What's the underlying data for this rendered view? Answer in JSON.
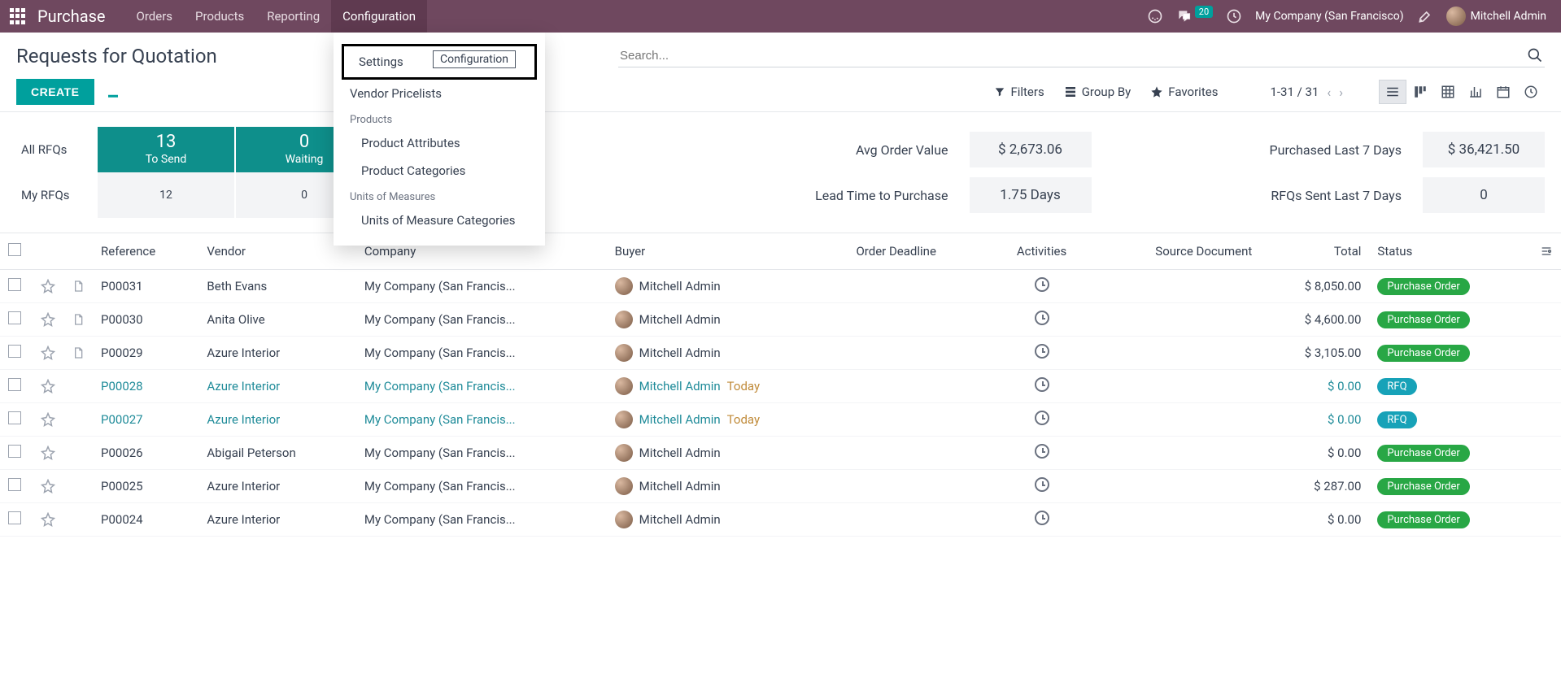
{
  "nav": {
    "app": "Purchase",
    "items": [
      "Orders",
      "Products",
      "Reporting",
      "Configuration"
    ],
    "active_index": 3,
    "msg_count": "20",
    "company": "My Company (San Francisco)",
    "user": "Mitchell Admin"
  },
  "dropdown": {
    "tooltip": "Configuration",
    "items": [
      {
        "label": "Settings",
        "type": "item",
        "boxed": true
      },
      {
        "label": "Vendor Pricelists",
        "type": "item"
      },
      {
        "label": "Products",
        "type": "header"
      },
      {
        "label": "Product Attributes",
        "type": "item",
        "indent": true
      },
      {
        "label": "Product Categories",
        "type": "item",
        "indent": true
      },
      {
        "label": "Units of Measures",
        "type": "header"
      },
      {
        "label": "Units of Measure Categories",
        "type": "item",
        "indent": true
      }
    ]
  },
  "cp": {
    "title": "Requests for Quotation",
    "create": "CREATE",
    "search_placeholder": "Search...",
    "filters": "Filters",
    "groupby": "Group By",
    "favorites": "Favorites",
    "pager": "1-31 / 31"
  },
  "dash": {
    "row_labels": [
      "All RFQs",
      "My RFQs"
    ],
    "cards": [
      {
        "big": "13",
        "sub": "To Send"
      },
      {
        "big": "0",
        "sub": "Waiting"
      }
    ],
    "my_row": [
      "12",
      "0"
    ],
    "kpis": [
      {
        "label": "Avg Order Value",
        "value": "$ 2,673.06"
      },
      {
        "label": "Purchased Last 7 Days",
        "value": "$ 36,421.50"
      },
      {
        "label": "Lead Time to Purchase",
        "value": "1.75 Days"
      },
      {
        "label": "RFQs Sent Last 7 Days",
        "value": "0"
      }
    ]
  },
  "table": {
    "headers": [
      "Reference",
      "Vendor",
      "Company",
      "Buyer",
      "Order Deadline",
      "Activities",
      "Source Document",
      "Total",
      "Status"
    ],
    "rows": [
      {
        "ref": "P00031",
        "vendor": "Beth Evans",
        "company": "My Company (San Francis...",
        "buyer": "Mitchell Admin",
        "deadline": "",
        "total": "$ 8,050.00",
        "status": "Purchase Order",
        "status_class": "status-po",
        "doc": true
      },
      {
        "ref": "P00030",
        "vendor": "Anita Olive",
        "company": "My Company (San Francis...",
        "buyer": "Mitchell Admin",
        "deadline": "",
        "total": "$ 4,600.00",
        "status": "Purchase Order",
        "status_class": "status-po",
        "doc": true
      },
      {
        "ref": "P00029",
        "vendor": "Azure Interior",
        "company": "My Company (San Francis...",
        "buyer": "Mitchell Admin",
        "deadline": "",
        "total": "$ 3,105.00",
        "status": "Purchase Order",
        "status_class": "status-po",
        "doc": true
      },
      {
        "ref": "P00028",
        "vendor": "Azure Interior",
        "company": "My Company (San Francis...",
        "buyer": "Mitchell Admin",
        "deadline": "Today",
        "total": "$ 0.00",
        "status": "RFQ",
        "status_class": "status-rfq",
        "link": true
      },
      {
        "ref": "P00027",
        "vendor": "Azure Interior",
        "company": "My Company (San Francis...",
        "buyer": "Mitchell Admin",
        "deadline": "Today",
        "total": "$ 0.00",
        "status": "RFQ",
        "status_class": "status-rfq",
        "link": true
      },
      {
        "ref": "P00026",
        "vendor": "Abigail Peterson",
        "company": "My Company (San Francis...",
        "buyer": "Mitchell Admin",
        "deadline": "",
        "total": "$ 0.00",
        "status": "Purchase Order",
        "status_class": "status-po"
      },
      {
        "ref": "P00025",
        "vendor": "Azure Interior",
        "company": "My Company (San Francis...",
        "buyer": "Mitchell Admin",
        "deadline": "",
        "total": "$ 287.00",
        "status": "Purchase Order",
        "status_class": "status-po"
      },
      {
        "ref": "P00024",
        "vendor": "Azure Interior",
        "company": "My Company (San Francis...",
        "buyer": "Mitchell Admin",
        "deadline": "",
        "total": "$ 0.00",
        "status": "Purchase Order",
        "status_class": "status-po"
      }
    ]
  }
}
